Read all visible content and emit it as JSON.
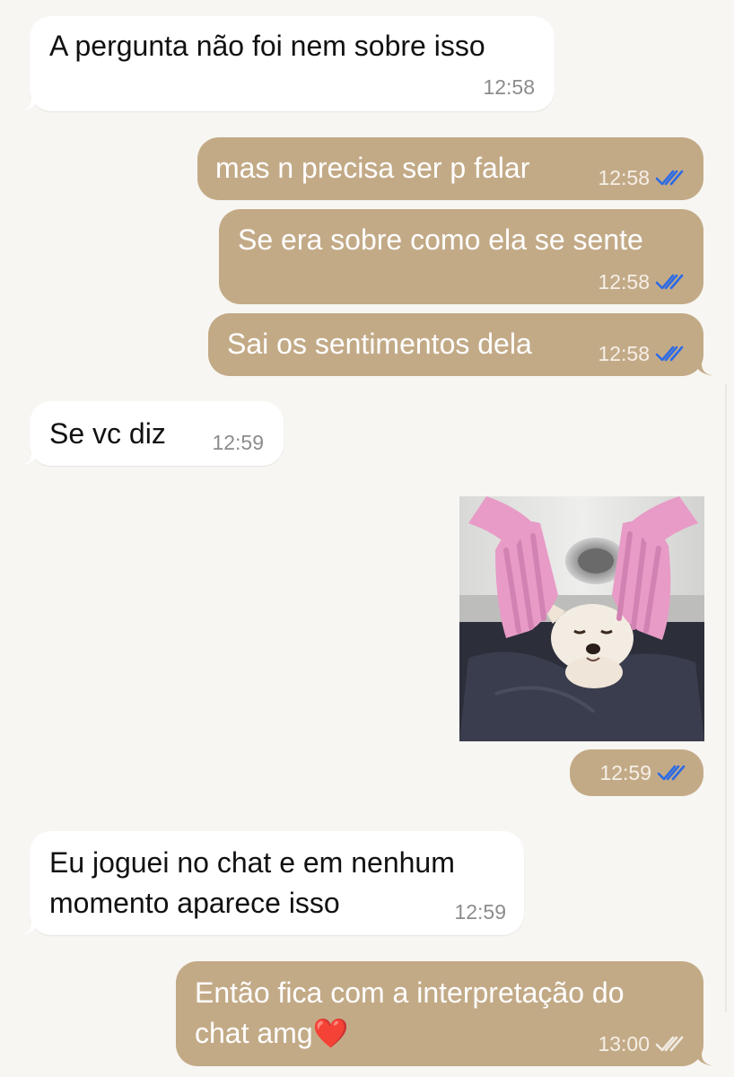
{
  "messages": [
    {
      "direction": "in",
      "text": "A pergunta não foi nem sobre isso",
      "time": "12:58"
    },
    {
      "direction": "out",
      "text": "mas n precisa ser p falar",
      "time": "12:58",
      "status": "read"
    },
    {
      "direction": "out",
      "text": "Se era sobre como ela se sente",
      "time": "12:58",
      "status": "read"
    },
    {
      "direction": "out",
      "text": "Sai os sentimentos dela",
      "time": "12:58",
      "status": "read"
    },
    {
      "direction": "in",
      "text": "Se vc diz",
      "time": "12:59"
    },
    {
      "direction": "out",
      "type": "sticker",
      "time": "12:59",
      "status": "read"
    },
    {
      "direction": "in",
      "text_line1": "Eu joguei no chat e em nenhum",
      "text_line2": "momento aparece isso",
      "time": "12:59"
    },
    {
      "direction": "out",
      "text_line1": "Então fica com a interpretação do",
      "text_line2": "chat amg",
      "emoji": "❤️",
      "time": "13:00",
      "status": "delivered"
    }
  ],
  "icons": {
    "read_tick": "double-check-icon",
    "delivered_tick": "double-check-icon"
  },
  "colors": {
    "background": "#f7f6f2",
    "incoming_bubble": "#ffffff",
    "outgoing_bubble": "#c3aa87",
    "read_tick": "#2d6be4",
    "delivered_tick": "#f0ebe3"
  }
}
